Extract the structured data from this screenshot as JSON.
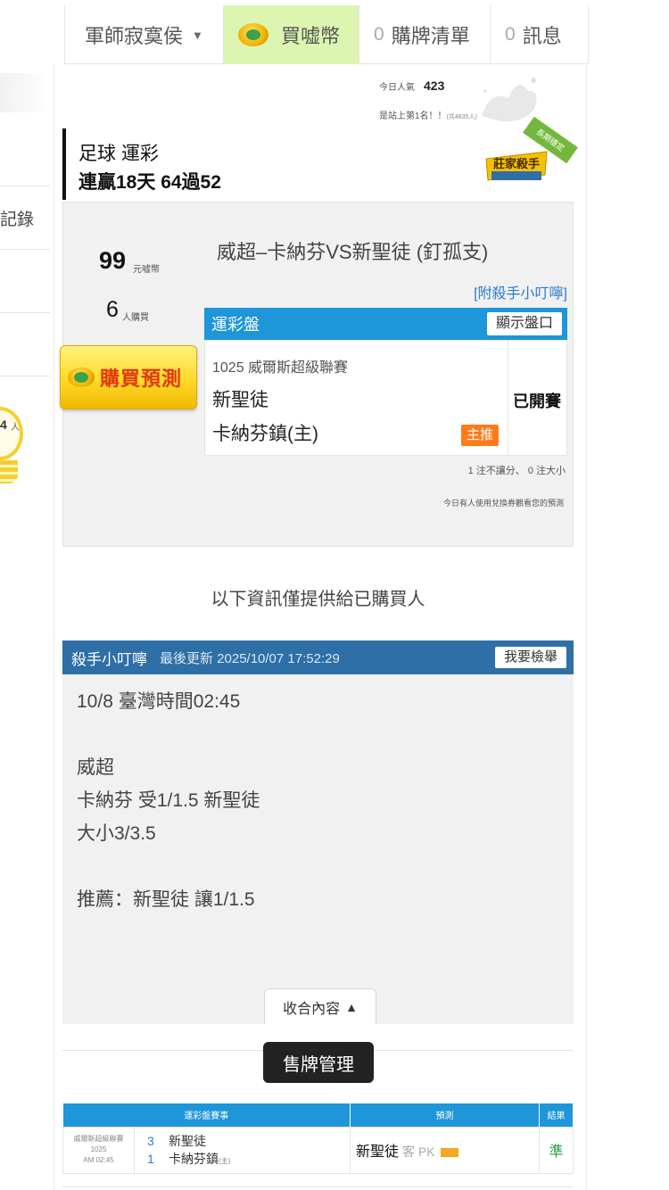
{
  "nav": {
    "user": "軍師寂寞侯",
    "buy": "買嘘幣",
    "list_count": "0",
    "list": "購牌清單",
    "msg_count": "0",
    "msg": "訊息"
  },
  "left": {
    "items": [
      "",
      "記錄",
      "",
      ""
    ],
    "bulb_num": "4",
    "bulb_unit": "人"
  },
  "stats": {
    "popularity_label": "今日人氣",
    "popularity_value": "423",
    "rank_text": "是站上第1名！！",
    "rank_small": "(共4835人)"
  },
  "header": {
    "line1": "足球 運彩",
    "line2": "連贏18天 64過52",
    "badge": "莊家殺手",
    "ribbon": "長期穩定"
  },
  "card": {
    "price": "99",
    "price_unit": "元嘘幣",
    "buyers": "6",
    "buyers_unit": "人購買",
    "buy_button": "購買預測",
    "match_title": "威超–卡納芬VS新聖徒 (釘孤支)",
    "attach_link": "[附殺手小叮嚀]",
    "odds_title": "運彩盤",
    "show_odds": "顯示盤口",
    "league_line": "1025 威爾斯超級聯賽",
    "team_away": "新聖徒",
    "team_home": "卡納芬鎮(主)",
    "main_tag": "主推",
    "status": "已開賽",
    "note_bets": "1 注不讓分、 0 注大小",
    "note_coupon": "今日有人使用兌換券觀看您的預測"
  },
  "info_only": "以下資訊僅提供給已購買人",
  "tip": {
    "title": "殺手小叮嚀",
    "updated": "最後更新 2025/10/07 17:52:29",
    "report": "我要檢舉",
    "lines": [
      "10/8 臺灣時間02:45",
      "",
      "威超",
      "卡納芬 受1/1.5 新聖徒",
      "大小3/3.5",
      "",
      "推薦：新聖徒 讓1/1.5"
    ],
    "collapse": "收合內容"
  },
  "sell_button": "售牌管理",
  "table": {
    "headers": [
      "運彩盤賽事",
      "預測",
      "結果"
    ],
    "row": {
      "league": "威爾斯超級聯賽",
      "code": "1025",
      "time": "AM 02:45",
      "away_score": "3",
      "away": "新聖徒",
      "home_score": "1",
      "home": "卡納芬鎮",
      "home_mark": "(主)",
      "pred_team": "新聖徒",
      "pred_type": "客 PK",
      "result": "準"
    }
  },
  "colors": {
    "accent_blue": "#1e96d9",
    "header_blue": "#2d6fa6",
    "buy_green": "#dcf5b0",
    "tag_orange": "#ff7a1a",
    "result_green": "#2a9d3b"
  }
}
